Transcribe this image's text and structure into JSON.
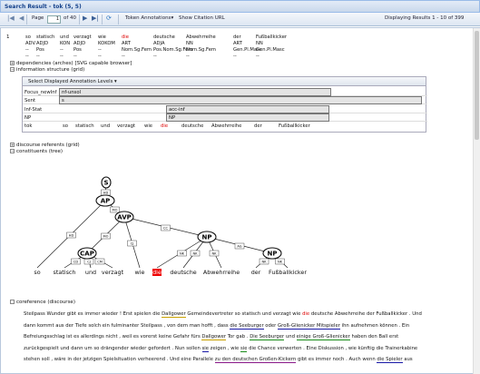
{
  "window": {
    "title": "Search Result - tok (5, 5)"
  },
  "toolbar": {
    "page_label": "Page",
    "page_value": "1",
    "page_of": "of 40",
    "token_annotations": "Token Annotations",
    "token_annotations_arrow": "▾",
    "citation": "Show Citation URL",
    "status": "Displaying Results 1 - 10 of 399",
    "first_icon": "|◀",
    "prev_icon": "◀",
    "next_icon": "▶",
    "last_icon": "▶|",
    "refresh_icon": "⟳"
  },
  "kwic": {
    "index": "1",
    "tokens": [
      "so",
      "statisch",
      "und",
      "verzagt",
      "wie",
      "die",
      "deutsche",
      "Abwehrreihe",
      "der",
      "Fußballkicker"
    ],
    "pos": [
      "ADV",
      "ADJD",
      "KON",
      "ADJD",
      "KOKOM",
      "ART",
      "ADJA",
      "NN",
      "ART",
      "NN"
    ],
    "morph": [
      "--",
      "Pos",
      "--",
      "Pos",
      "--",
      "Nom.Sg.Fem",
      "Pos.Nom.Sg.Fem",
      "Nom.Sg.Fem",
      "Gen.Pl.Masc",
      "Gen.Pl.Masc"
    ],
    "morph3": [
      "--",
      "--",
      "--",
      "--",
      "--",
      "--",
      "--",
      "--",
      "--",
      "--"
    ]
  },
  "expanders": {
    "dependencies": "dependencies (arches) [SVG capable browser]",
    "information": "information structure (grid)",
    "discourse": "discourse referents (grid)",
    "constituents": "constituents (tree)",
    "coreference": "coreference (discourse)"
  },
  "grid": {
    "select_levels": "Select Displayed Annotation Levels",
    "rows": [
      "Focus_newInf",
      "Sent",
      "Inf-Stat",
      "NP",
      "tok"
    ],
    "focus_value": "nf-unsol",
    "sent_value": "s",
    "infstat_value": "acc-inf",
    "np_value": "NP",
    "tok_values": [
      "so",
      "statisch",
      "und",
      "verzagt",
      "wie",
      "die",
      "deutsche",
      "Abwehrreihe",
      "der",
      "Fußballkicker"
    ]
  },
  "tree": {
    "nodes": [
      "S",
      "AP",
      "AVP",
      "CAP",
      "NP",
      "NP"
    ],
    "edges": [
      "HD",
      "MO",
      "HD",
      "MO",
      "CC",
      "CJ",
      "CD",
      "CJ",
      "CM",
      "NK",
      "NK",
      "NK",
      "AG",
      "NK",
      "NK"
    ],
    "leaves": [
      "so",
      "statisch",
      "und",
      "verzagt",
      "wie",
      "die",
      "deutsche",
      "Abwehrreihe",
      "der",
      "Fußballkicker"
    ]
  },
  "coref_lines": [
    [
      [
        "Steilpass Wunder gibt es immer wieder ! Erst spielen die ",
        ""
      ],
      [
        "Dallgower",
        "u1"
      ],
      [
        " Gemeindevertreter so statisch und verzagt wie ",
        ""
      ],
      [
        "die",
        "kw"
      ],
      [
        " deutsche Abwehrreihe ",
        ""
      ],
      [
        "der Fußballkicker",
        ""
      ],
      [
        " . Und",
        ""
      ]
    ],
    [
      [
        "dann kommt aus der Tiefe solch ein fulminanter Steilpass , von dem man hofft , dass ",
        ""
      ],
      [
        "die Seeburger",
        "u2"
      ],
      [
        " oder ",
        ""
      ],
      [
        "Groß-Glienicker Mitspieler",
        "u2"
      ],
      [
        " ihn aufnehmen können . Ein",
        ""
      ]
    ],
    [
      [
        "Befreiungsschlag ist es allerdings nicht , weil es vorerst keine Gefahr fürs ",
        ""
      ],
      [
        "Dallgower",
        "u1"
      ],
      [
        " Tor gab . ",
        ""
      ],
      [
        "Die Seeburger",
        "u3"
      ],
      [
        " und ",
        ""
      ],
      [
        "einige Groß-Glienicker",
        "u3"
      ],
      [
        " haben den Ball erst",
        ""
      ]
    ],
    [
      [
        "zurückgespielt und dann um so drängender wieder gefordert . Nun sollen ",
        ""
      ],
      [
        "sie",
        "u2"
      ],
      [
        " zeigen , wie ",
        ""
      ],
      [
        "sie",
        "u3"
      ],
      [
        " die Chance verwerten . Eine Diskussion , wie künftig die Trainerkabine",
        ""
      ]
    ],
    [
      [
        "stehen soll , wäre in der jetzigen Spielsituation verheerend . Und eine Parallele ",
        ""
      ],
      [
        "zu den deutschen Großen-Kickern",
        "u4"
      ],
      [
        " gibt es immer noch . Auch wenn ",
        ""
      ],
      [
        "die Spieler",
        "u2"
      ],
      [
        " aus",
        ""
      ]
    ]
  ]
}
